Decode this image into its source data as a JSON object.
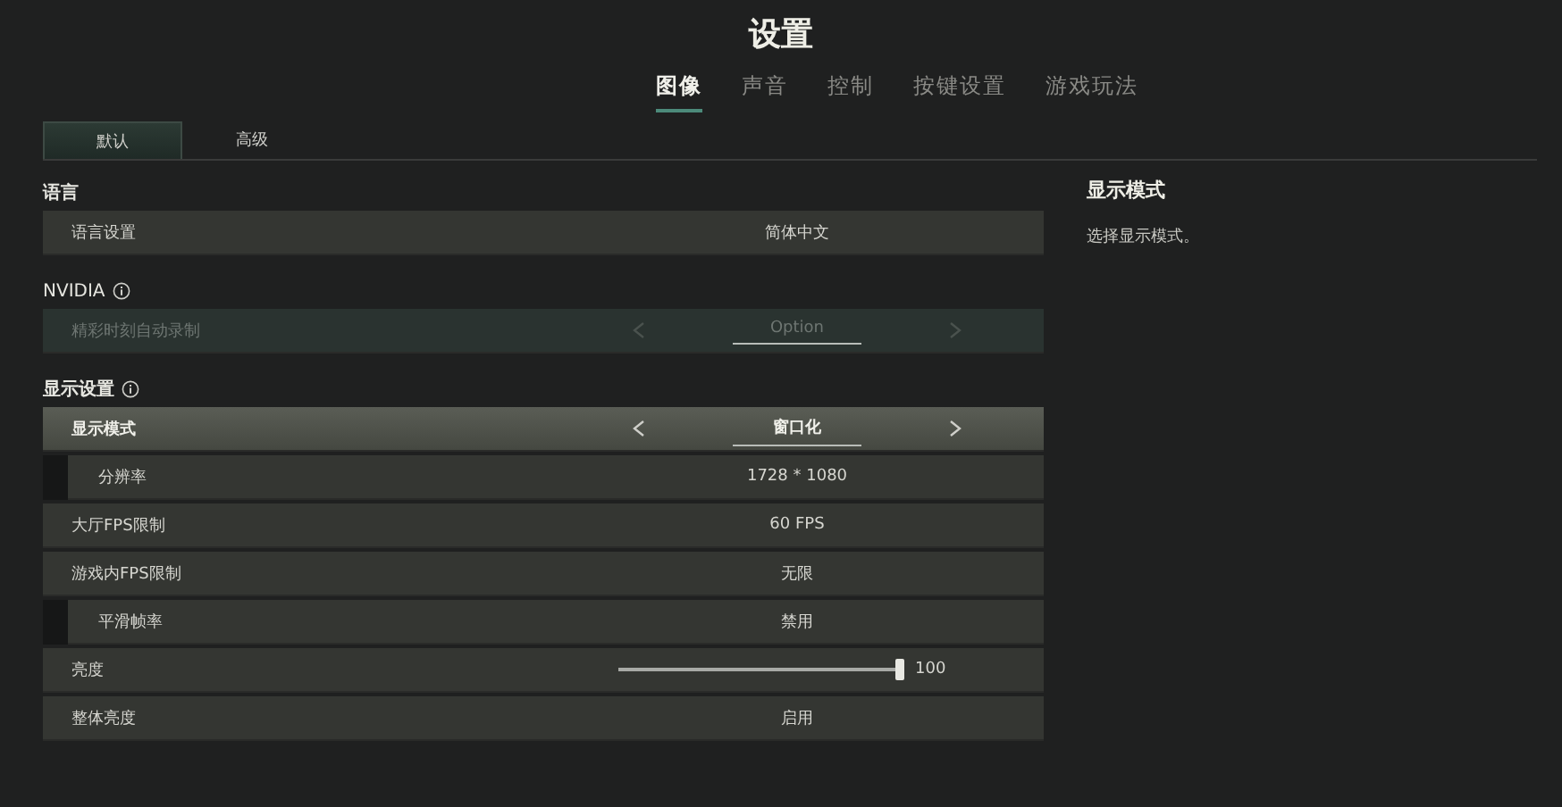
{
  "title": "设置",
  "nav_tabs": [
    {
      "label": "图像",
      "selected": true
    },
    {
      "label": "声音",
      "selected": false
    },
    {
      "label": "控制",
      "selected": false
    },
    {
      "label": "按键设置",
      "selected": false
    },
    {
      "label": "游戏玩法",
      "selected": false
    }
  ],
  "sub_tabs": [
    {
      "label": "默认",
      "selected": true
    },
    {
      "label": "高级",
      "selected": false
    }
  ],
  "sections": [
    {
      "title": "语言",
      "info": false,
      "rows": [
        {
          "kind": "value",
          "label": "语言设置",
          "value": "简体中文",
          "indented": false,
          "disabled": false,
          "selected": false
        }
      ]
    },
    {
      "title": "NVIDIA",
      "info": true,
      "rows": [
        {
          "kind": "select",
          "label": "精彩时刻自动录制",
          "value": "Option",
          "indented": false,
          "disabled": true,
          "selected": false
        }
      ]
    },
    {
      "title": "显示设置",
      "info": true,
      "rows": [
        {
          "kind": "select",
          "label": "显示模式",
          "value": "窗口化",
          "indented": false,
          "disabled": false,
          "selected": true
        },
        {
          "kind": "value",
          "label": "分辨率",
          "value": "1728 * 1080",
          "indented": true,
          "disabled": false,
          "selected": false
        },
        {
          "kind": "value",
          "label": "大厅FPS限制",
          "value": "60 FPS",
          "indented": false,
          "disabled": false,
          "selected": false
        },
        {
          "kind": "value",
          "label": "游戏内FPS限制",
          "value": "无限",
          "indented": false,
          "disabled": false,
          "selected": false
        },
        {
          "kind": "value",
          "label": "平滑帧率",
          "value": "禁用",
          "indented": true,
          "disabled": false,
          "selected": false
        },
        {
          "kind": "slider",
          "label": "亮度",
          "value": "100",
          "level": 1,
          "indented": false,
          "disabled": false,
          "selected": false
        },
        {
          "kind": "value",
          "label": "整体亮度",
          "value": "启用",
          "indented": false,
          "disabled": false,
          "selected": false
        }
      ]
    }
  ],
  "description": {
    "title": "显示模式",
    "text": "选择显示模式。"
  }
}
